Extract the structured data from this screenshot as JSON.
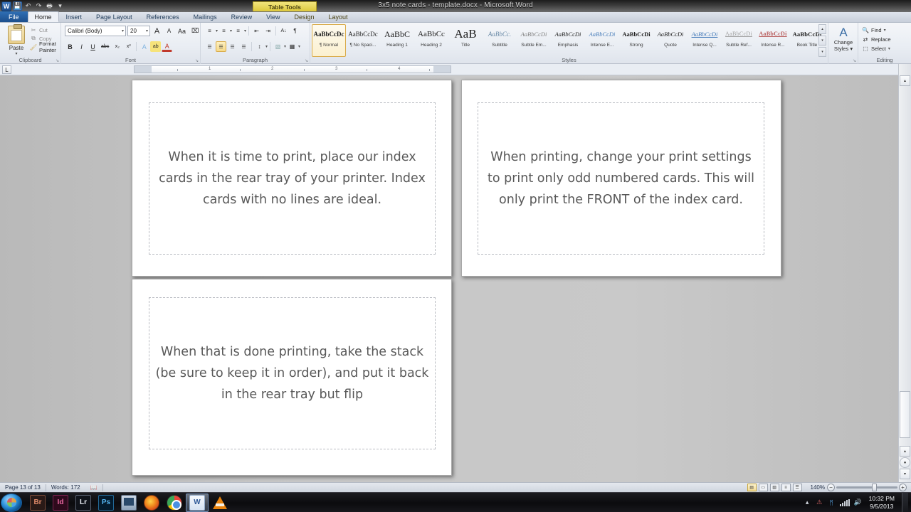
{
  "window": {
    "title": "3x5 note cards - template.docx - Microsoft Word",
    "contextual_tab_group": "Table Tools",
    "minimize": "–",
    "maximize": "❐",
    "close": "✕",
    "help": "?"
  },
  "quick_access": {
    "word_mark": "W",
    "save": "💾",
    "undo": "↶",
    "redo": "↷",
    "print_preview": "🖶",
    "customize": "▾"
  },
  "tabs": [
    {
      "label": "File",
      "type": "file"
    },
    {
      "label": "Home",
      "type": "active"
    },
    {
      "label": "Insert",
      "type": "normal"
    },
    {
      "label": "Page Layout",
      "type": "normal"
    },
    {
      "label": "References",
      "type": "normal"
    },
    {
      "label": "Mailings",
      "type": "normal"
    },
    {
      "label": "Review",
      "type": "normal"
    },
    {
      "label": "View",
      "type": "normal"
    },
    {
      "label": "Design",
      "type": "contextual"
    },
    {
      "label": "Layout",
      "type": "contextual"
    }
  ],
  "ribbon": {
    "clipboard": {
      "group_label": "Clipboard",
      "paste_label": "Paste",
      "paste_arrow": "▾",
      "cut": "Cut",
      "copy": "Copy",
      "format_painter": "Format Painter",
      "cut_icon": "✂",
      "copy_icon": "⧉",
      "painter_icon": "🖌",
      "dialog_launcher": "↘"
    },
    "font": {
      "group_label": "Font",
      "font_name": "Calibri (Body)",
      "font_size": "20",
      "grow_font": "A",
      "shrink_font": "A",
      "change_case": "Aa",
      "clear_formatting": "⌧",
      "bold": "B",
      "italic": "I",
      "underline": "U",
      "strikethrough": "abc",
      "subscript": "x₂",
      "superscript": "x²",
      "text_effects": "A",
      "highlight": "ab",
      "font_color": "A",
      "dialog_launcher": "↘"
    },
    "paragraph": {
      "group_label": "Paragraph",
      "bullets": "≡",
      "numbering": "≡",
      "multilevel": "≡",
      "decrease_indent": "⇤",
      "increase_indent": "⇥",
      "sort": "A↓",
      "show_marks": "¶",
      "align_left": "☰",
      "align_center": "☰",
      "align_right": "☰",
      "justify": "☰",
      "line_spacing": "↕",
      "shading": "▧",
      "borders": "▦",
      "active_alignment": "align_center",
      "dialog_launcher": "↘"
    },
    "styles": {
      "group_label": "Styles",
      "items": [
        {
          "preview": "AaBbCcDc",
          "name": "¶ Normal",
          "selected": true
        },
        {
          "preview": "AaBbCcDc",
          "name": "¶ No Spaci...",
          "selected": false
        },
        {
          "preview": "AaBbC",
          "name": "Heading 1",
          "selected": false
        },
        {
          "preview": "AaBbCc",
          "name": "Heading 2",
          "selected": false
        },
        {
          "preview": "AaB",
          "name": "Title",
          "selected": false
        },
        {
          "preview": "AaBbCc.",
          "name": "Subtitle",
          "selected": false
        },
        {
          "preview": "AaBbCcDi",
          "name": "Subtle Em...",
          "selected": false
        },
        {
          "preview": "AaBbCcDi",
          "name": "Emphasis",
          "selected": false
        },
        {
          "preview": "AaBbCcDi",
          "name": "Intense E...",
          "selected": false
        },
        {
          "preview": "AaBbCcDi",
          "name": "Strong",
          "selected": false
        },
        {
          "preview": "AaBbCcDi",
          "name": "Quote",
          "selected": false
        },
        {
          "preview": "AaBbCcDi",
          "name": "Intense Q...",
          "selected": false
        },
        {
          "preview": "AaBbCcDi",
          "name": "Subtle Ref...",
          "selected": false
        },
        {
          "preview": "AaBbCcDi",
          "name": "Intense R...",
          "selected": false
        },
        {
          "preview": "AaBbCcDi",
          "name": "Book Title",
          "selected": false
        }
      ],
      "scroll_up": "▴",
      "scroll_down": "▾",
      "more": "▾",
      "dialog_launcher": "↘"
    },
    "change_styles": {
      "label_line1": "Change",
      "label_line2": "Styles ▾",
      "icon": "A"
    },
    "editing": {
      "group_label": "Editing",
      "find": "Find",
      "replace": "Replace",
      "select": "Select",
      "find_icon": "🔍",
      "replace_icon": "⇄",
      "select_icon": "⬚",
      "arrow": "▾"
    }
  },
  "ruler": {
    "tab_selector": "L",
    "marks": [
      "1",
      "2",
      "3",
      "4"
    ]
  },
  "document": {
    "pages": [
      {
        "id": "page-1",
        "text": "When it is time to print, place our index cards in the rear tray of your printer.  Index cards with no lines are ideal."
      },
      {
        "id": "page-2",
        "text": "When printing, change your print settings to print only odd numbered cards.  This will only print the FRONT of the index card."
      },
      {
        "id": "page-3",
        "text": "When that is done printing, take the stack (be sure to keep it in order), and put it back in the rear tray but flip"
      }
    ]
  },
  "scrollbar": {
    "up_arrow": "▴",
    "down_arrow": "▾",
    "prev_page": "▴",
    "select_browse": "●",
    "next_page": "▾",
    "view_ruler": "▤"
  },
  "status_bar": {
    "page": "Page 13 of 13",
    "words": "Words: 172",
    "proofing_icon": "📖",
    "zoom": "140%",
    "zoom_out": "−",
    "zoom_in": "+",
    "views": [
      {
        "name": "print-layout",
        "glyph": "▤",
        "active": true
      },
      {
        "name": "full-screen-reading",
        "glyph": "▭",
        "active": false
      },
      {
        "name": "web-layout",
        "glyph": "▧",
        "active": false
      },
      {
        "name": "outline",
        "glyph": "≡",
        "active": false
      },
      {
        "name": "draft",
        "glyph": "☰",
        "active": false
      }
    ]
  },
  "taskbar": {
    "start": "start-orb",
    "apps": [
      {
        "name": "adobe-bridge",
        "glyph": "Br",
        "class": "ic-br",
        "active": false
      },
      {
        "name": "adobe-indesign",
        "glyph": "Id",
        "class": "ic-id",
        "active": false
      },
      {
        "name": "adobe-lightroom",
        "glyph": "Lr",
        "class": "ic-lr",
        "active": false
      },
      {
        "name": "adobe-photoshop",
        "glyph": "Ps",
        "class": "ic-ps",
        "active": false
      },
      {
        "name": "remote-desktop",
        "glyph": "",
        "class": "ic-mon",
        "active": false
      },
      {
        "name": "mozilla-firefox",
        "glyph": "",
        "class": "ic-ff",
        "active": false
      },
      {
        "name": "google-chrome",
        "glyph": "",
        "class": "ic-ch",
        "active": false
      },
      {
        "name": "microsoft-word",
        "glyph": "W",
        "class": "ic-w",
        "active": true
      },
      {
        "name": "vlc-media-player",
        "glyph": "",
        "class": "ic-vlc",
        "active": false
      }
    ],
    "tray": {
      "show_hidden": "▴",
      "bluetooth": "ᛗ",
      "network": "network-bars",
      "volume": "🔊",
      "action": "⚠",
      "time": "10:32 PM",
      "date": "9/5/2013"
    }
  }
}
